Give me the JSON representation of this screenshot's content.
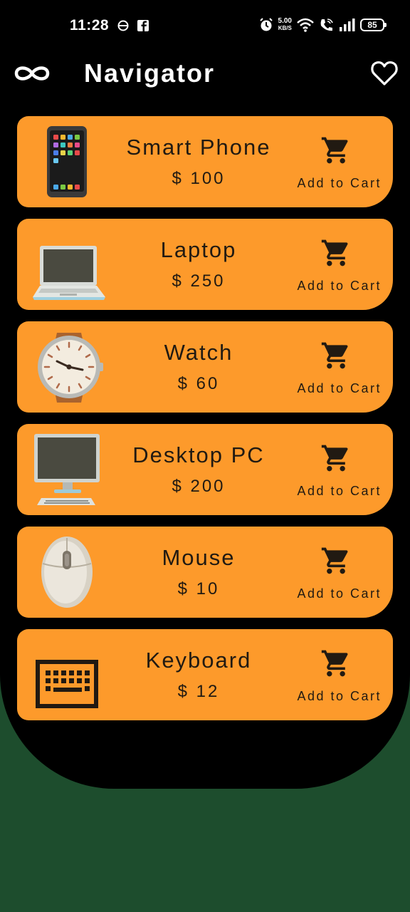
{
  "status_bar": {
    "time": "11:28",
    "speed_value": "5.00",
    "speed_unit": "KB/S",
    "battery": "85"
  },
  "app_bar": {
    "title": "Navigator"
  },
  "products": [
    {
      "name": "Smart Phone",
      "price": "$ 100",
      "cart_label": "Add to Cart",
      "icon": "smartphone-icon"
    },
    {
      "name": "Laptop",
      "price": "$ 250",
      "cart_label": "Add to Cart",
      "icon": "laptop-icon"
    },
    {
      "name": "Watch",
      "price": "$ 60",
      "cart_label": "Add to Cart",
      "icon": "watch-icon"
    },
    {
      "name": "Desktop PC",
      "price": "$ 200",
      "cart_label": "Add to Cart",
      "icon": "desktop-pc-icon"
    },
    {
      "name": "Mouse",
      "price": "$ 10",
      "cart_label": "Add to Cart",
      "icon": "mouse-icon"
    },
    {
      "name": "Keyboard",
      "price": "$ 12",
      "cart_label": "Add to Cart",
      "icon": "keyboard-icon"
    }
  ],
  "colors": {
    "panel": "#000000",
    "background": "#1d4d2d",
    "card": "#fd9a2b",
    "text": "#211a12"
  }
}
